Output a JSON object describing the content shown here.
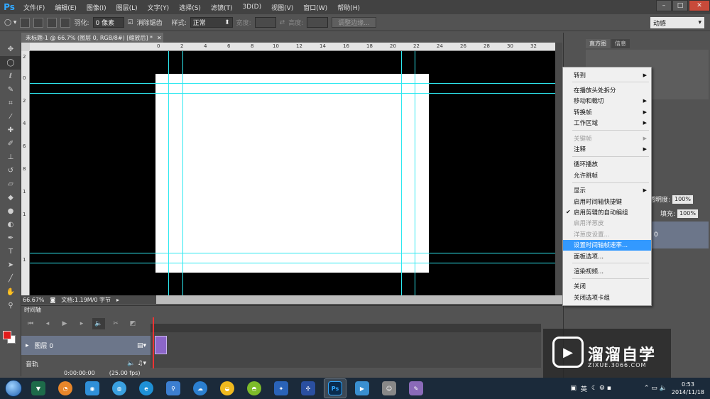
{
  "app": {
    "logo": "Ps"
  },
  "menubar": [
    "文件(F)",
    "编辑(E)",
    "图像(I)",
    "图层(L)",
    "文字(Y)",
    "选择(S)",
    "滤镜(T)",
    "3D(D)",
    "视图(V)",
    "窗口(W)",
    "帮助(H)"
  ],
  "window_controls": {
    "minimize": "–",
    "restore": "□",
    "close": "✕"
  },
  "options": {
    "feather_label": "羽化:",
    "feather_value": "0 像素",
    "antialias_label": "消除锯齿",
    "style_label": "样式:",
    "style_value": "正常",
    "width_label": "宽度:",
    "height_label": "高度:",
    "refine_edge": "调整边缘...",
    "workspace": "动感"
  },
  "document": {
    "tab_title": "未标题-1 @ 66.7% (图层 0, RGB/8#) [缩放后] *",
    "zoom": "66.67%",
    "doc_info": "文档:1.19M/0 字节"
  },
  "ruler_h": [
    "2",
    "0",
    "2",
    "4",
    "6",
    "8",
    "10",
    "12",
    "14",
    "16",
    "18",
    "20",
    "22",
    "24",
    "26",
    "28",
    "30",
    "32",
    "34",
    "36"
  ],
  "ruler_v": [
    "2",
    "0",
    "2",
    "4",
    "6",
    "8",
    "1",
    "1",
    "1"
  ],
  "timeline": {
    "tab": "时间轴",
    "layer_name": "图层 0",
    "audio_track": "音轨",
    "timecode": "0:00:00:00",
    "fps": "(25.00 fps)"
  },
  "panels": {
    "tabs": [
      "直方图",
      "信息"
    ],
    "opacity_label": "不透明度:",
    "opacity_value": "100%",
    "fill_label": "填充:",
    "fill_value": "100%",
    "layer_index": "0"
  },
  "context_menu": [
    {
      "label": "转到",
      "submenu": true,
      "disabled": false
    },
    {
      "sep": true
    },
    {
      "label": "在播放头处拆分",
      "submenu": false,
      "disabled": false
    },
    {
      "label": "移动和裁切",
      "submenu": true,
      "disabled": false
    },
    {
      "label": "转换帧",
      "submenu": true,
      "disabled": false
    },
    {
      "label": "工作区域",
      "submenu": true,
      "disabled": false
    },
    {
      "sep": true
    },
    {
      "label": "关键帧",
      "submenu": true,
      "disabled": true
    },
    {
      "label": "注释",
      "submenu": true,
      "disabled": false
    },
    {
      "sep": true
    },
    {
      "label": "循环播放",
      "submenu": false,
      "disabled": false
    },
    {
      "label": "允许跳帧",
      "submenu": false,
      "disabled": false
    },
    {
      "sep": true
    },
    {
      "label": "显示",
      "submenu": true,
      "disabled": false
    },
    {
      "label": "启用时间轴快捷键",
      "submenu": false,
      "disabled": false
    },
    {
      "label": "启用剪辑的自动编组",
      "submenu": false,
      "disabled": false,
      "checked": true
    },
    {
      "label": "启用洋葱皮",
      "submenu": false,
      "disabled": true
    },
    {
      "label": "洋葱皮设置...",
      "submenu": false,
      "disabled": true
    },
    {
      "label": "设置时间轴帧速率...",
      "submenu": false,
      "disabled": false,
      "highlight": true
    },
    {
      "label": "面板选项...",
      "submenu": false,
      "disabled": false
    },
    {
      "sep": true
    },
    {
      "label": "渲染视频...",
      "submenu": false,
      "disabled": false
    },
    {
      "sep": true
    },
    {
      "label": "关闭",
      "submenu": false,
      "disabled": false
    },
    {
      "label": "关闭选项卡组",
      "submenu": false,
      "disabled": false
    }
  ],
  "watermark": {
    "title": "溜溜自学",
    "url": "ZIXUE.3066.COM"
  },
  "taskbar": {
    "icons": [
      "ps-icon-label"
    ],
    "ps_label": "Ps",
    "tray_text": "英",
    "time": "0:53",
    "date": "2014/11/18"
  }
}
